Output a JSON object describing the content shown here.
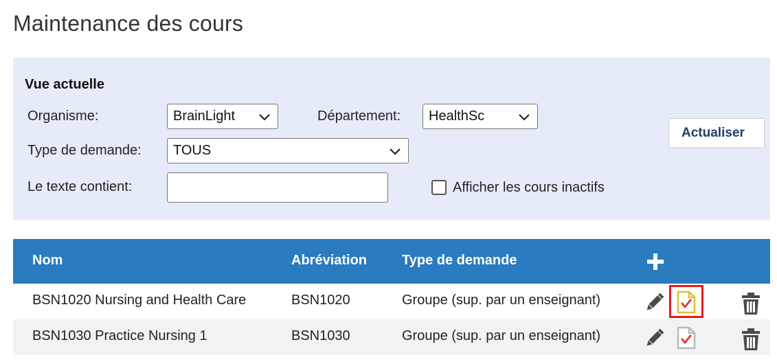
{
  "page": {
    "title": "Maintenance des cours"
  },
  "filters": {
    "heading": "Vue actuelle",
    "organisme": {
      "label": "Organisme:",
      "value": "BrainLight"
    },
    "departement": {
      "label": "Département:",
      "value": "HealthSc"
    },
    "type_demande": {
      "label": "Type de demande:",
      "value": "TOUS"
    },
    "texte": {
      "label": "Le texte contient:",
      "value": ""
    },
    "inactifs": {
      "label": "Afficher les cours inactifs",
      "checked": false
    },
    "refresh_label": "Actualiser"
  },
  "table": {
    "columns": {
      "nom": "Nom",
      "abreviation": "Abréviation",
      "type": "Type de demande"
    },
    "rows": [
      {
        "nom": "BSN1020 Nursing and Health Care",
        "abreviation": "BSN1020",
        "type": "Groupe (sup. par un enseignant)",
        "doc_status": "active"
      },
      {
        "nom": "BSN1030 Practice Nursing 1",
        "abreviation": "BSN1030",
        "type": "Groupe (sup. par un enseignant)",
        "doc_status": "inactive"
      }
    ]
  },
  "icons": {
    "add": "plus-icon",
    "edit": "pencil-icon",
    "doc": "document-check-icon",
    "delete": "trash-icon"
  },
  "colors": {
    "header_bg": "#2a7bc0",
    "panel_bg": "#e6ebfa",
    "doc_active": "#e8b92a",
    "check_mark": "#e03a3a",
    "highlight": "#e11d1d"
  }
}
